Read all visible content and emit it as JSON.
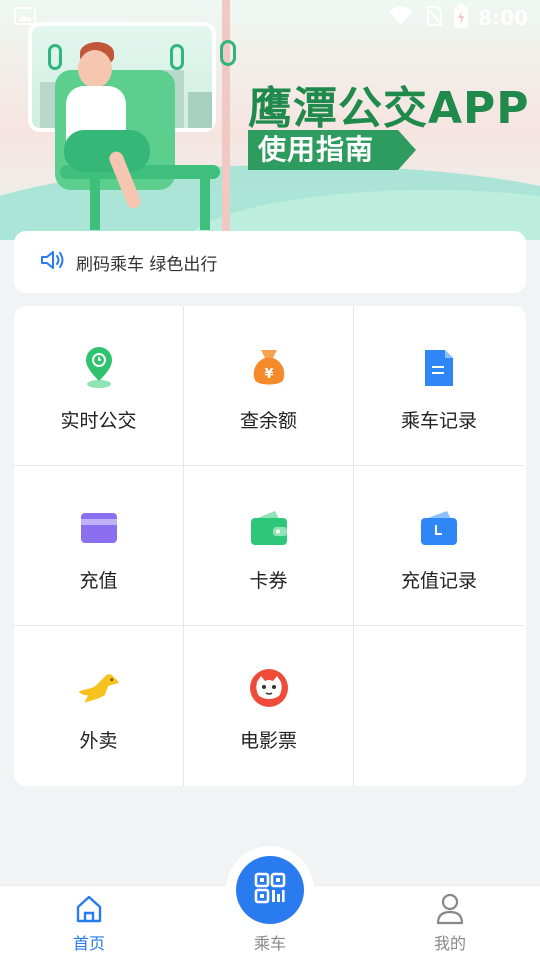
{
  "status_bar": {
    "time": "8:00",
    "icons": [
      "image-icon",
      "wifi-icon",
      "no-sim-icon",
      "battery-charging-icon"
    ]
  },
  "banner": {
    "title": "鹰潭公交APP",
    "subtitle": "使用指南",
    "colors": {
      "title": "#1f8a4c",
      "subtitle_bg": "#2f9c5f"
    }
  },
  "notice": {
    "icon": "speaker-icon",
    "text": "刷码乘车 绿色出行"
  },
  "grid": {
    "items": [
      {
        "label": "实时公交",
        "icon": "bus-location-pin-icon",
        "color": "#2fc36e"
      },
      {
        "label": "查余额",
        "icon": "money-bag-icon",
        "color": "#f58a2a"
      },
      {
        "label": "乘车记录",
        "icon": "document-icon",
        "color": "#2f86f6"
      },
      {
        "label": "充值",
        "icon": "card-icon",
        "color": "#8a6ff0"
      },
      {
        "label": "卡券",
        "icon": "wallet-icon",
        "color": "#2ec77a"
      },
      {
        "label": "充值记录",
        "icon": "wallet-record-icon",
        "color": "#2f86f6"
      },
      {
        "label": "外卖",
        "icon": "kangaroo-icon",
        "color": "#f7c21f"
      },
      {
        "label": "电影票",
        "icon": "cat-icon",
        "color": "#ef4b3b"
      }
    ]
  },
  "tabbar": {
    "home": {
      "label": "首页",
      "icon": "home-icon"
    },
    "ride": {
      "label": "乘车",
      "icon": "qr-code-icon"
    },
    "mine": {
      "label": "我的",
      "icon": "user-icon"
    },
    "active": "home",
    "colors": {
      "active": "#2a7bf0",
      "inactive": "#888888"
    }
  }
}
